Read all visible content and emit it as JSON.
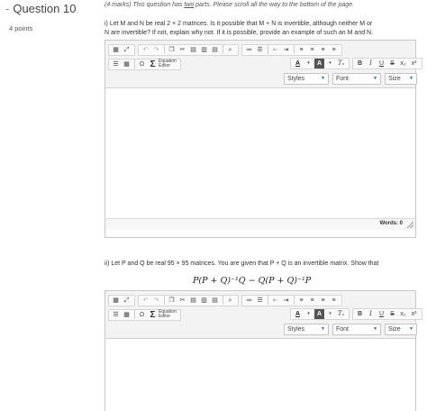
{
  "question": {
    "dash": "-",
    "title": "Question 10",
    "points": "4 points"
  },
  "intro": {
    "prefix": "(4 marks) This question has ",
    "underlined": "two",
    "suffix": " parts. Please scroll all the way to the bottom of the page."
  },
  "part1": {
    "line1": "i) Let M and N be real 2 × 2 matrices. Is it possible that M + N is invertible, although neither M or",
    "line2": "N are invertible? If not, explain why not. If it is possible, provide an example of such an M and N."
  },
  "part2": {
    "line1": "ii) Let P and Q be real 95 × 95 matrices. You are given that P + Q is an invertible matrix. Show that",
    "formula": "P(P + Q)⁻¹Q − Q(P + Q)⁻¹P"
  },
  "toolbar": {
    "equation_line1": "Equation",
    "equation_line2": "Editor",
    "styles": "Styles",
    "font": "Font",
    "size": "Size",
    "icons": {
      "source": "▦",
      "maximize": "⤢",
      "undo": "↶",
      "redo": "↷",
      "copy": "❐",
      "cut": "✂",
      "paste": "📋",
      "paste_text": "▤",
      "paste_word": "▥",
      "find": "🔍",
      "numbered": "≔",
      "bullets": "☰",
      "outdent": "⇤",
      "indent": "⇥",
      "align_left": "≡",
      "align_center": "≡",
      "align_right": "≡",
      "justify": "≡",
      "hr": "☰",
      "table": "▦",
      "omega": "Ω",
      "sigma": "Σ",
      "text_color": "A",
      "bg_color": "A",
      "clear_format": "Tₓ",
      "bold": "B",
      "italic": "I",
      "underline": "U",
      "strike": "S",
      "subscript": "x₂",
      "superscript": "x²"
    }
  },
  "editor1": {
    "words_label": "Words: 0"
  }
}
